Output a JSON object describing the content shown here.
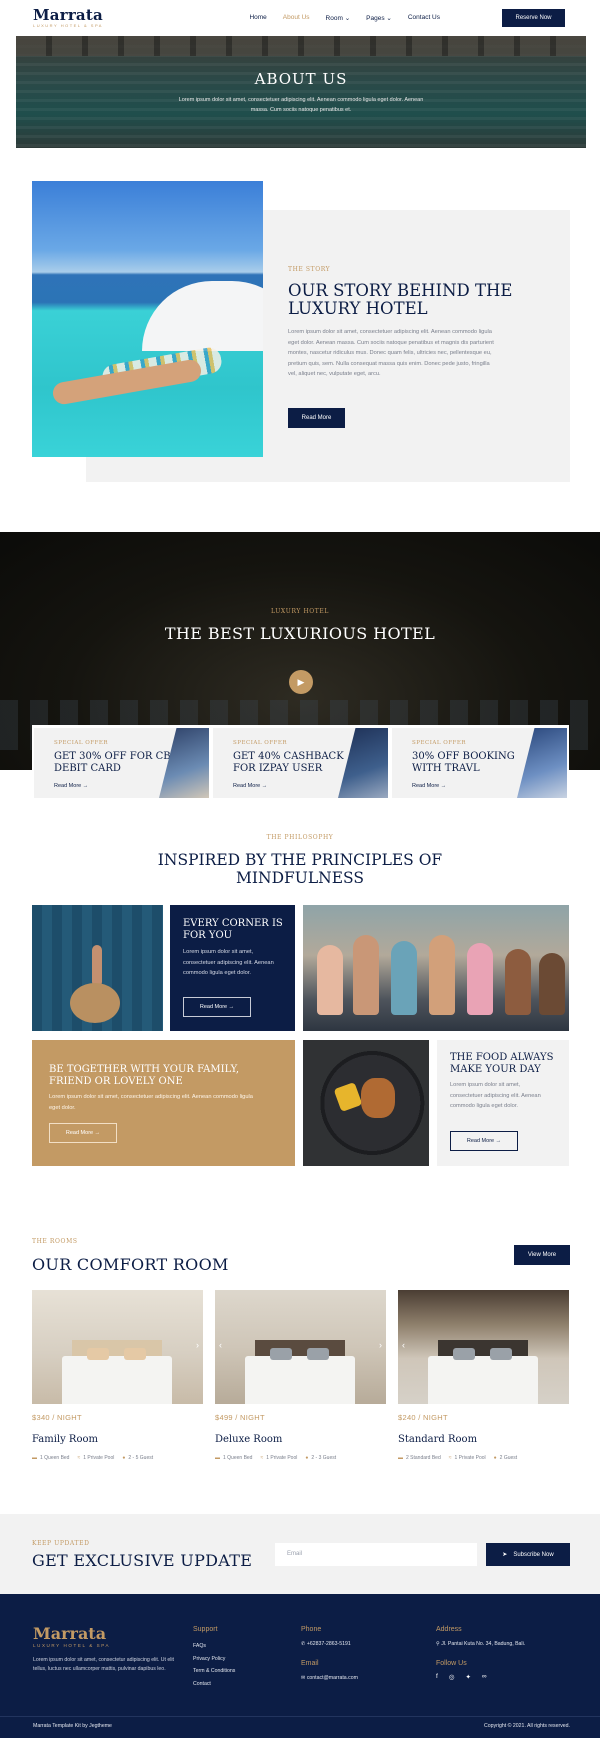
{
  "header": {
    "logo": "Marrata",
    "logo_tagline": "LUXURY HOTEL & SPA",
    "nav": [
      "Home",
      "About Us",
      "Room",
      "Pages",
      "Contact Us"
    ],
    "nav_active": "About Us",
    "reserve_label": "Reserve Now"
  },
  "hero": {
    "title": "ABOUT US",
    "subtitle": "Lorem ipsum dolor sit amet, consectetuer adipiscing elit. Aenean commodo ligula eget dolor. Aenean massa. Cum sociis natoque penatibus et."
  },
  "story": {
    "label": "THE STORY",
    "title": "OUR STORY BEHIND THE LUXURY HOTEL",
    "text": "Lorem ipsum dolor sit amet, consectetuer adipiscing elit. Aenean commodo ligula eget dolor. Aenean massa. Cum sociis natoque penatibus et magnis dis parturient montes, nascetur ridiculus mus. Donec quam felis, ultricies nec, pellentesque eu, pretium quis, sem. Nulla consequat massa quis enim. Donec pede justo, fringilla vel, aliquet nec, vulputate eget, arcu.",
    "button": "Read More"
  },
  "video": {
    "label": "LUXURY HOTEL",
    "title": "THE BEST LUXURIOUS HOTEL"
  },
  "offers": [
    {
      "label": "SPECIAL OFFER",
      "title": "GET 30% OFF FOR CBC DEBIT CARD",
      "link": "Read More"
    },
    {
      "label": "SPECIAL OFFER",
      "title": "GET 40% CASHBACK FOR IZPAY USER",
      "link": "Read More"
    },
    {
      "label": "SPECIAL OFFER",
      "title": "30% OFF BOOKING WITH TRAVL",
      "link": "Read More"
    }
  ],
  "philosophy": {
    "label": "THE PHILOSOPHY",
    "title": "INSPIRED BY THE PRINCIPLES OF MINDFULNESS",
    "corner": {
      "title": "EVERY CORNER IS FOR YOU",
      "text": "Lorem ipsum dolor sit amet, consectetuer adipiscing elit. Aenean commodo ligula eget dolor.",
      "button": "Read More"
    },
    "family": {
      "title": "BE TOGETHER WITH YOUR FAMILY, FRIEND OR LOVELY ONE",
      "text": "Lorem ipsum dolor sit amet, consectetuer adipiscing elit. Aenean commodo ligula eget dolor.",
      "button": "Read More"
    },
    "food": {
      "title": "THE FOOD ALWAYS MAKE YOUR DAY",
      "text": "Lorem ipsum dolor sit amet, consectetuer adipiscing elit. Aenean commodo ligula eget dolor.",
      "button": "Read More"
    }
  },
  "rooms": {
    "label": "THE ROOMS",
    "title": "OUR COMFORT ROOM",
    "view_more": "View More",
    "items": [
      {
        "price": "$340 / NIGHT",
        "name": "Family Room",
        "f1": "1 Queen Bed",
        "f2": "1 Private Pool",
        "f3": "2 - 5 Guest"
      },
      {
        "price": "$499 / NIGHT",
        "name": "Deluxe Room",
        "f1": "1 Queen Bed",
        "f2": "1 Private Pool",
        "f3": "2 - 3 Guest"
      },
      {
        "price": "$240 / NIGHT",
        "name": "Standard Room",
        "f1": "2 Standard Bed",
        "f2": "1 Private Pool",
        "f3": "2 Guest"
      }
    ]
  },
  "newsletter": {
    "label": "KEEP UPDATED",
    "title": "GET EXCLUSIVE UPDATE",
    "placeholder": "Email",
    "button": "Subscribe Now"
  },
  "footer": {
    "logo": "Marrata",
    "logo_tagline": "LUXURY HOTEL & SPA",
    "about": "Lorem ipsum dolor sit amet, consectetur adipiscing elit. Ut elit tellus, luctus nec ullamcorper mattis, pulvinar dapibus leo.",
    "support_head": "Support",
    "support": [
      "FAQs",
      "Privacy Policy",
      "Term & Conditions",
      "Contact"
    ],
    "phone_head": "Phone",
    "phone": "+62837-2863-5191",
    "email_head": "Email",
    "email": "contact@marrata.com",
    "address_head": "Address",
    "address": "Jl. Pantai Kuta No. 34, Badung, Bali.",
    "follow_head": "Follow Us",
    "copy_left": "Marrata Template Kit by Jegtheme",
    "copy_right": "Copyright © 2021. All rights reserved."
  }
}
